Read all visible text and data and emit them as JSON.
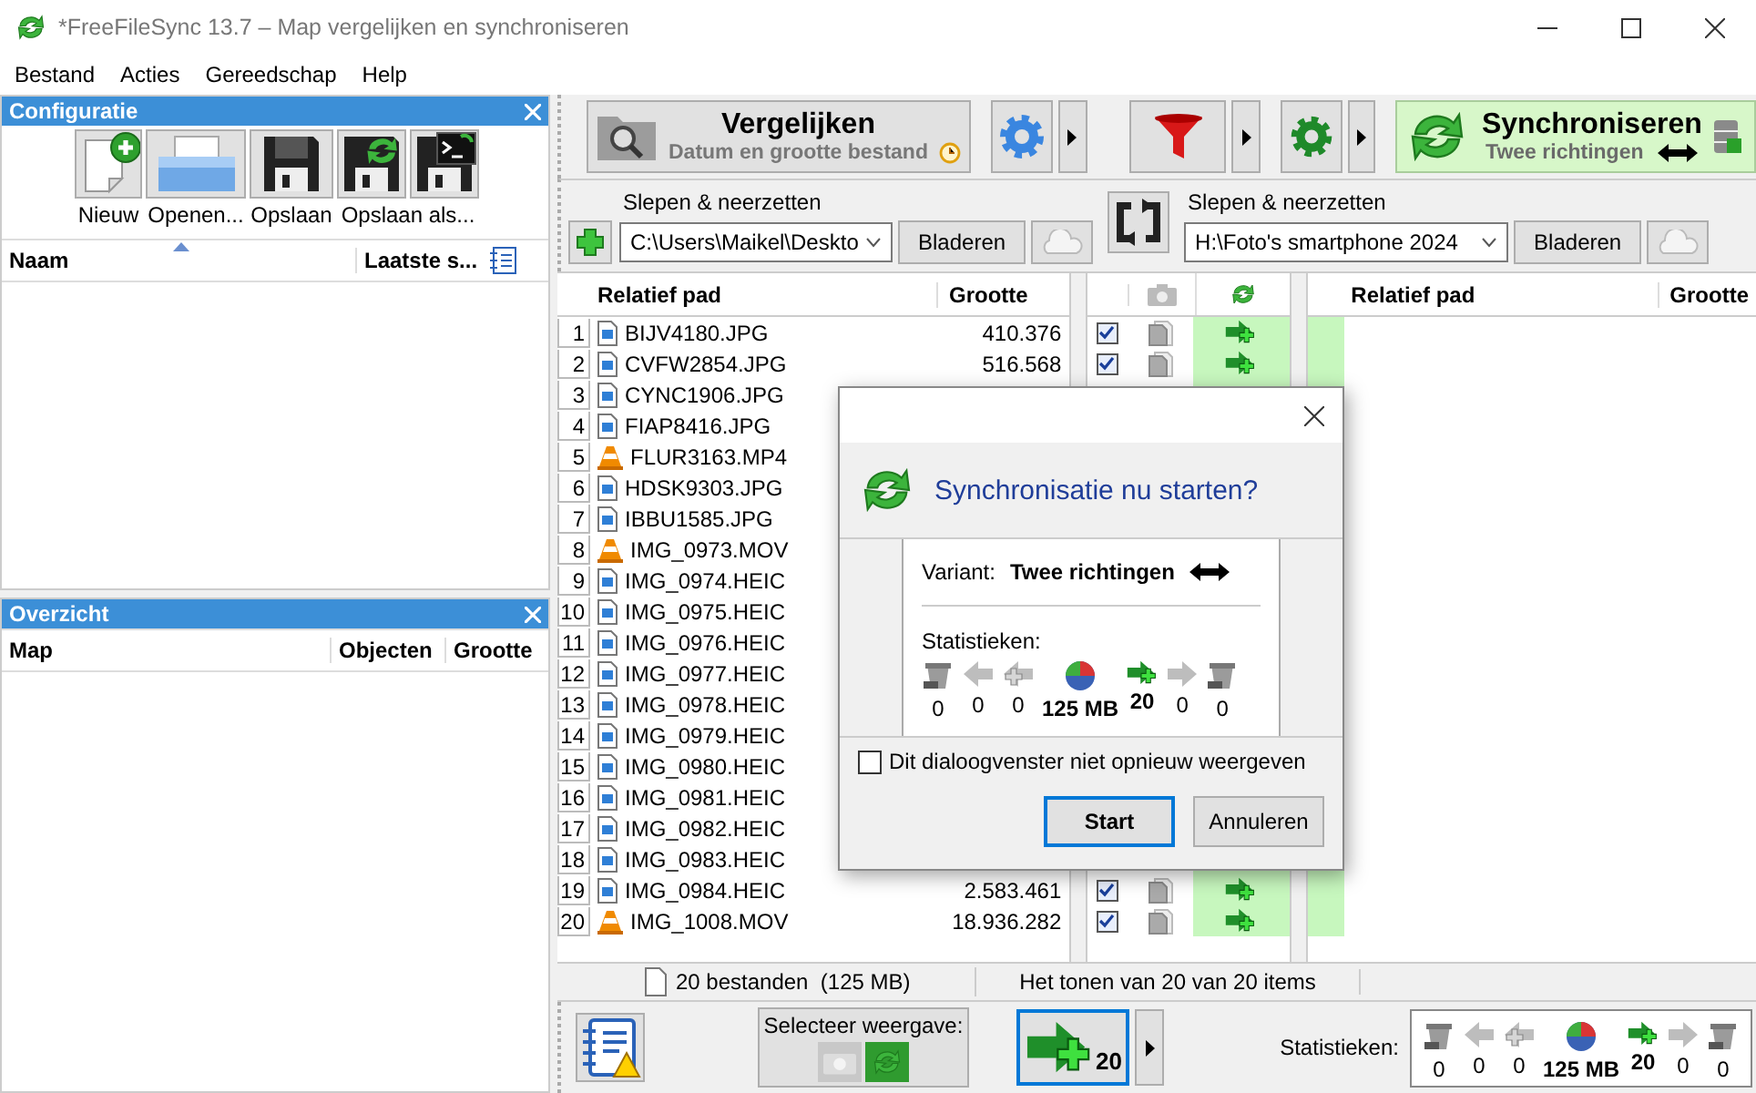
{
  "window": {
    "title": "*FreeFileSync 13.7 – Map vergelijken en synchroniseren"
  },
  "menu": [
    "Bestand",
    "Acties",
    "Gereedschap",
    "Help"
  ],
  "config_panel": {
    "title": "Configuratie",
    "buttons": [
      {
        "kind": "new",
        "label": "Nieuw"
      },
      {
        "kind": "open",
        "label": "Openen..."
      },
      {
        "kind": "save",
        "label": "Opslaan"
      },
      {
        "kind": "save-as",
        "label": "Opslaan als..."
      },
      {
        "kind": "save-batch"
      }
    ],
    "columns": [
      "Naam",
      "Laatste s..."
    ]
  },
  "overview_panel": {
    "title": "Overzicht",
    "columns": [
      "Map",
      "Objecten",
      "Grootte"
    ]
  },
  "compare_button": {
    "title": "Vergelijken",
    "subtitle": "Datum en grootte bestand"
  },
  "sync_button": {
    "title": "Synchroniseren",
    "subtitle": "Twee richtingen"
  },
  "left_folder": {
    "label": "Slepen & neerzetten",
    "path": "C:\\Users\\Maikel\\Deskto",
    "browse": "Bladeren"
  },
  "right_folder": {
    "label": "Slepen & neerzetten",
    "path": "H:\\Foto's smartphone 2024",
    "browse": "Bladeren"
  },
  "left_grid": {
    "columns": [
      "Relatief pad",
      "Grootte"
    ],
    "rows": [
      {
        "number": "1",
        "kind": "image",
        "name": "BIJV4180.JPG",
        "size": "410.376",
        "checked": true
      },
      {
        "number": "2",
        "kind": "image",
        "name": "CVFW2854.JPG",
        "size": "516.568",
        "checked": true
      },
      {
        "number": "3",
        "kind": "image",
        "name": "CYNC1906.JPG"
      },
      {
        "number": "4",
        "kind": "image",
        "name": "FIAP8416.JPG"
      },
      {
        "number": "5",
        "kind": "video",
        "name": "FLUR3163.MP4"
      },
      {
        "number": "6",
        "kind": "image",
        "name": "HDSK9303.JPG"
      },
      {
        "number": "7",
        "kind": "image",
        "name": "IBBU1585.JPG"
      },
      {
        "number": "8",
        "kind": "video",
        "name": "IMG_0973.MOV"
      },
      {
        "number": "9",
        "kind": "image",
        "name": "IMG_0974.HEIC"
      },
      {
        "number": "10",
        "kind": "image",
        "name": "IMG_0975.HEIC"
      },
      {
        "number": "11",
        "kind": "image",
        "name": "IMG_0976.HEIC"
      },
      {
        "number": "12",
        "kind": "image",
        "name": "IMG_0977.HEIC"
      },
      {
        "number": "13",
        "kind": "image",
        "name": "IMG_0978.HEIC"
      },
      {
        "number": "14",
        "kind": "image",
        "name": "IMG_0979.HEIC"
      },
      {
        "number": "15",
        "kind": "image",
        "name": "IMG_0980.HEIC"
      },
      {
        "number": "16",
        "kind": "image",
        "name": "IMG_0981.HEIC"
      },
      {
        "number": "17",
        "kind": "image",
        "name": "IMG_0982.HEIC"
      },
      {
        "number": "18",
        "kind": "image",
        "name": "IMG_0983.HEIC"
      },
      {
        "number": "19",
        "kind": "image",
        "name": "IMG_0984.HEIC",
        "size": "2.583.461",
        "checked": true
      },
      {
        "number": "20",
        "kind": "video",
        "name": "IMG_1008.MOV",
        "size": "18.936.282",
        "checked": true
      }
    ]
  },
  "right_grid": {
    "columns": [
      "Relatief pad",
      "Grootte"
    ]
  },
  "status_bar": {
    "files": "20 bestanden  (125 MB)",
    "showing": "Het tonen van 20 van 20 items"
  },
  "view_selector": {
    "label": "Selecteer weergave:",
    "options": [
      {
        "kind": "compare",
        "selected": false
      },
      {
        "kind": "sync",
        "selected": true
      }
    ]
  },
  "sync_count": "20",
  "statistics": {
    "label": "Statistieken:",
    "items": [
      {
        "kind": "trash",
        "value": "0",
        "active": false
      },
      {
        "kind": "arrow-left",
        "value": "0",
        "active": false
      },
      {
        "kind": "plus-left",
        "value": "0",
        "active": false
      },
      {
        "kind": "pie",
        "value": "125 MB",
        "active": true
      },
      {
        "kind": "plus-right",
        "value": "20",
        "active": true
      },
      {
        "kind": "arrow-right",
        "value": "0",
        "active": false
      },
      {
        "kind": "trash",
        "value": "0",
        "active": false
      }
    ]
  },
  "dialog": {
    "title": "Synchronisatie nu starten?",
    "variant_label": "Variant:",
    "variant": "Twee richtingen",
    "stats_label": "Statistieken:",
    "stats": [
      {
        "kind": "trash",
        "value": "0",
        "active": false
      },
      {
        "kind": "arrow-left",
        "value": "0",
        "active": false
      },
      {
        "kind": "plus-left",
        "value": "0",
        "active": false
      },
      {
        "kind": "pie",
        "value": "125 MB",
        "active": true
      },
      {
        "kind": "plus-right",
        "value": "20",
        "active": true
      },
      {
        "kind": "arrow-right",
        "value": "0",
        "active": false
      },
      {
        "kind": "trash",
        "value": "0",
        "active": false
      }
    ],
    "dont_show": {
      "label": "Dit dialoogvenster niet opnieuw weergeven",
      "checked": false
    },
    "buttons": [
      "Start",
      "Annuleren"
    ]
  }
}
